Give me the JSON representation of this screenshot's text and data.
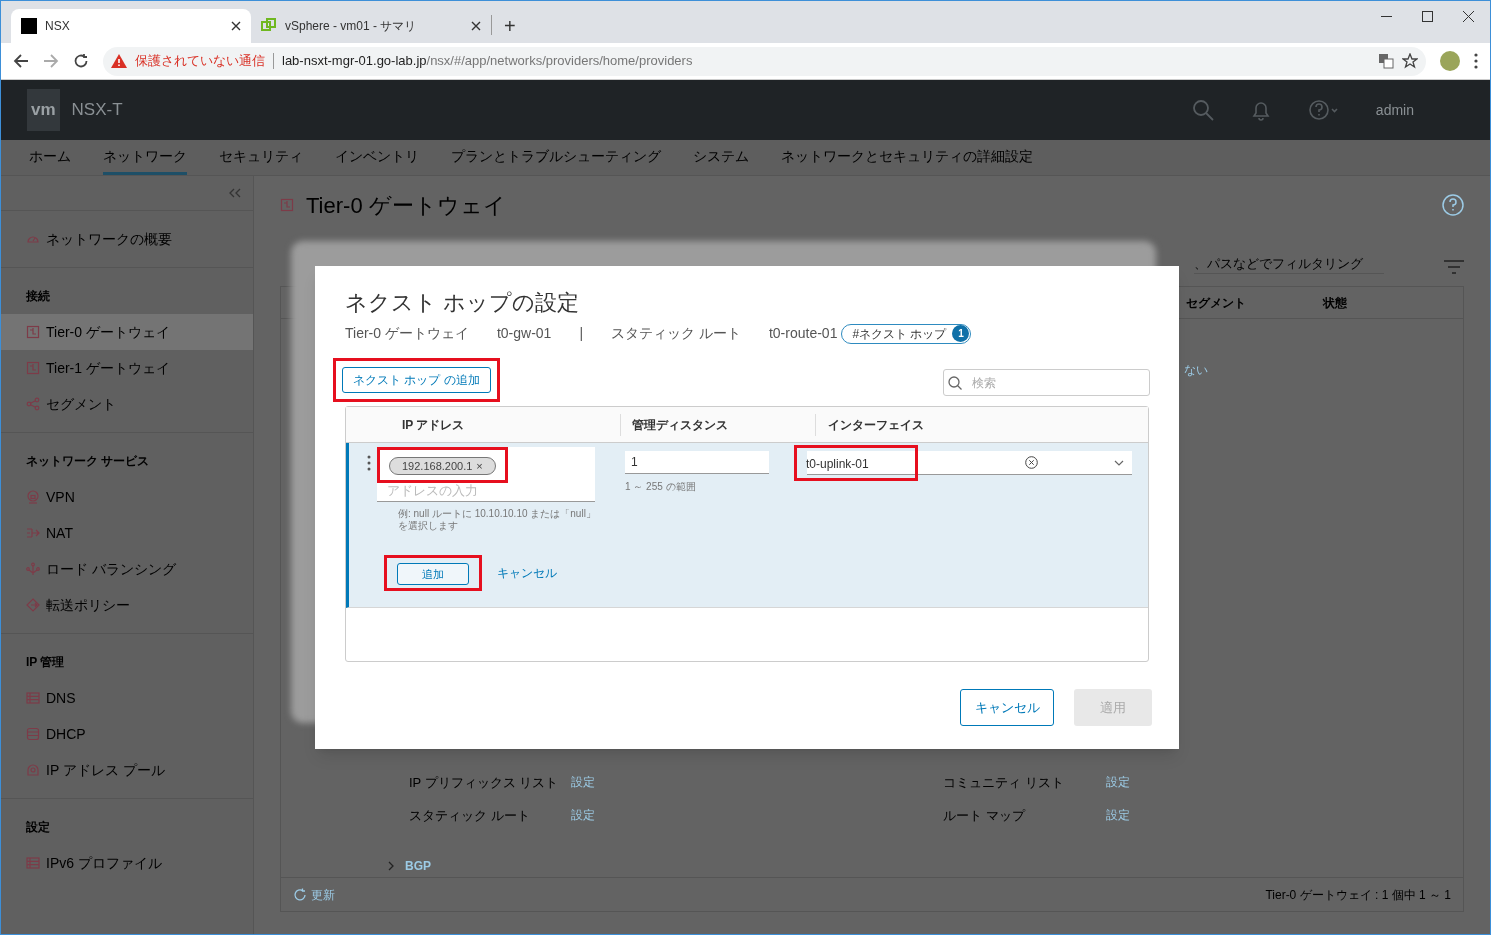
{
  "browser": {
    "tabs": [
      {
        "title": "NSX",
        "selected": true
      },
      {
        "title": "vSphere - vm01 - サマリ",
        "selected": false
      }
    ],
    "new_tab": "+",
    "warning": "保護されていない通信",
    "host": "lab-nsxt-mgr-01.go-lab.jp",
    "path": "/nsx/#/app/networks/providers/home/providers"
  },
  "app": {
    "logo": "vm",
    "name": "NSX-T",
    "user": "admin"
  },
  "nav": [
    {
      "label": "ホーム",
      "selected": false
    },
    {
      "label": "ネットワーク",
      "selected": true
    },
    {
      "label": "セキュリティ",
      "selected": false
    },
    {
      "label": "インベントリ",
      "selected": false
    },
    {
      "label": "プランとトラブルシューティング",
      "selected": false
    },
    {
      "label": "システム",
      "selected": false
    },
    {
      "label": "ネットワークとセキュリティの詳細設定",
      "selected": false
    }
  ],
  "sidebar": {
    "sections": [
      {
        "items": [
          {
            "label": "ネットワークの概要",
            "kind": "gauge",
            "selected": false
          }
        ]
      },
      {
        "heading": "接続",
        "items": [
          {
            "label": "Tier-0 ゲートウェイ",
            "kind": "gateway",
            "selected": true
          },
          {
            "label": "Tier-1 ゲートウェイ",
            "kind": "gateway",
            "selected": false
          },
          {
            "label": "セグメント",
            "kind": "share",
            "selected": false
          }
        ]
      },
      {
        "heading": "ネットワーク サービス",
        "items": [
          {
            "label": "VPN",
            "kind": "lock",
            "selected": false
          },
          {
            "label": "NAT",
            "kind": "nat",
            "selected": false
          },
          {
            "label": "ロード バランシング",
            "kind": "balance",
            "selected": false
          },
          {
            "label": "転送ポリシー",
            "kind": "diamond",
            "selected": false
          }
        ]
      },
      {
        "heading": "IP 管理",
        "items": [
          {
            "label": "DNS",
            "kind": "server",
            "selected": false
          },
          {
            "label": "DHCP",
            "kind": "stack",
            "selected": false
          },
          {
            "label": "IP アドレス プール",
            "kind": "pool",
            "selected": false
          }
        ]
      },
      {
        "heading": "設定",
        "items": [
          {
            "label": "IPv6 プロファイル",
            "kind": "server",
            "selected": false
          }
        ]
      }
    ]
  },
  "page": {
    "title": "Tier-0 ゲートウェイ",
    "filter_placeholder": "、パスなどでフィルタリング",
    "columns": [
      "セグメント",
      "状態"
    ],
    "cell": "ない",
    "routing": [
      {
        "label": "IP プリフィックス リスト",
        "link": "設定"
      },
      {
        "label": "コミュニティ リスト",
        "link": "設定"
      },
      {
        "label": "スタティック ルート",
        "link": "設定"
      },
      {
        "label": "ルート マップ",
        "link": "設定"
      }
    ],
    "bgp": "BGP",
    "refresh": "更新",
    "count": "Tier-0 ゲートウェイ : 1 個中 1 ～ 1"
  },
  "modal": {
    "title": "ネクスト ホップの設定",
    "breadcrumb": [
      "Tier-0 ゲートウェイ",
      "t0-gw-01",
      "|",
      "スタティック ルート",
      "t0-route-01"
    ],
    "badge": {
      "label": "#ネクスト ホップ",
      "count": "1"
    },
    "add_button": {
      "label": "ネクスト ホップ の追加",
      "highlighted": true
    },
    "search_placeholder": "検索",
    "columns": [
      "IP アドレス",
      "管理ディスタンス",
      "インターフェイス"
    ],
    "row": {
      "ip": {
        "chip": "192.168.200.1",
        "chip_close": "×",
        "highlighted": true
      },
      "ip_placeholder": "アドレスの入力",
      "ip_hint": "例: null ルートに 10.10.10.10 または「null」を選択します",
      "distance": "1",
      "distance_hint": "1 ～ 255 の範囲",
      "interface": {
        "value": "t0-uplink-01",
        "highlighted": true
      },
      "add": {
        "label": "追加",
        "highlighted": true
      },
      "cancel": "キャンセル"
    },
    "cancel": "キャンセル",
    "apply": {
      "label": "適用",
      "disabled": true
    }
  }
}
